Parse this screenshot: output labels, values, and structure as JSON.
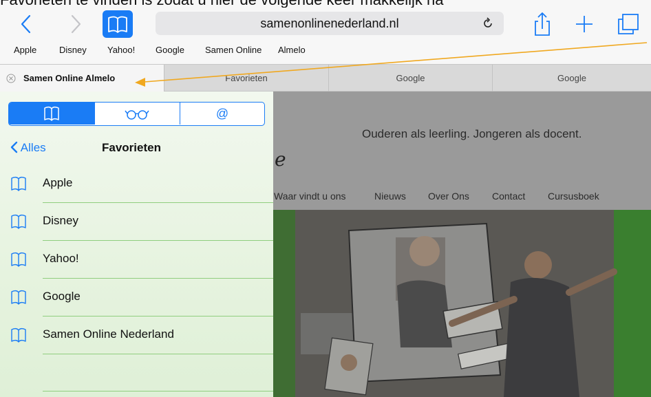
{
  "caption": "Favorieten te vinden is zodat u hier de volgende keer makkelijk na",
  "toolbar": {
    "url": "samenonlinenederland.nl",
    "back_icon": "chevron-left-icon",
    "forward_icon": "chevron-right-icon",
    "bookmarks_icon": "book-icon",
    "reload_icon": "reload-icon",
    "share_icon": "share-icon",
    "add_icon": "plus-icon",
    "tabs_icon": "tabs-icon"
  },
  "favorites_bar": [
    "Apple",
    "Disney",
    "Yahoo!",
    "Google",
    "Samen Online",
    "Almelo"
  ],
  "tabs": {
    "active_label": "Samen Online  Almelo",
    "items": [
      "Favorieten",
      "Google",
      "Google"
    ]
  },
  "sidebar": {
    "segments": [
      "book-icon",
      "reading-glasses-icon",
      "at-sign-icon"
    ],
    "back_label": "Alles",
    "title": "Favorieten",
    "bookmarks": [
      "Apple",
      "Disney",
      "Yahoo!",
      "Google",
      "Samen Online Nederland"
    ]
  },
  "webpage": {
    "tagline": "Ouderen als leerling. Jongeren als docent.",
    "logo_fragment": "e",
    "menu": [
      "Waar vindt u ons",
      "Nieuws",
      "Over Ons",
      "Contact",
      "Cursusboek"
    ]
  },
  "colors": {
    "accent": "#1a7cf5",
    "annotation_arrow": "#f0a820",
    "sidebar_divider": "#8fce7e",
    "page_green": "#2f8f2a"
  }
}
